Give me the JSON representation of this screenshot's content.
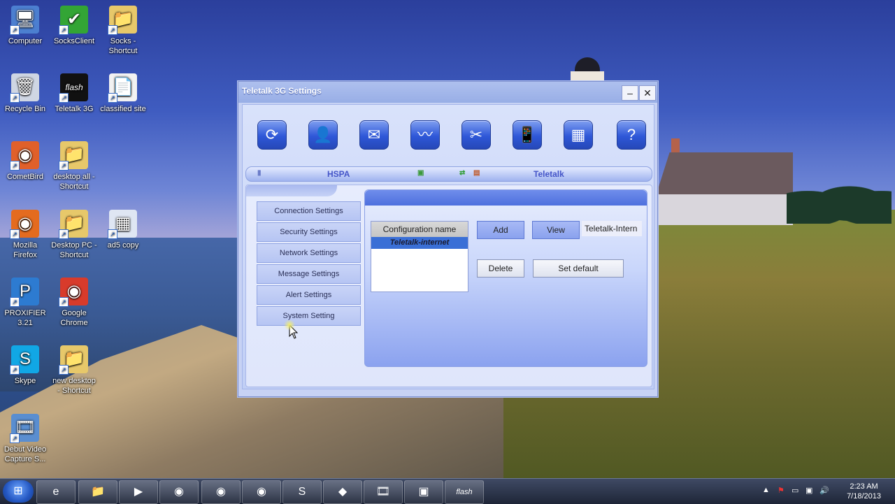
{
  "desktop": {
    "icons": [
      {
        "label": "Computer",
        "glyph": "🖥",
        "color": "#4c7fd0"
      },
      {
        "label": "SocksClient",
        "glyph": "✔",
        "color": "#33a535"
      },
      {
        "label": "Socks -\nShortcut",
        "glyph": "📁",
        "color": "#e7c86a"
      },
      {
        "label": "Recycle Bin",
        "glyph": "🗑",
        "color": "#cfd6e3"
      },
      {
        "label": "Teletalk 3G",
        "glyph": "flash",
        "color": "#111111"
      },
      {
        "label": "classified site",
        "glyph": "📄",
        "color": "#f2f2f2"
      },
      {
        "label": "CometBird",
        "glyph": "◉",
        "color": "#e0602a"
      },
      {
        "label": "desktop all -\nShortcut",
        "glyph": "📁",
        "color": "#e7c86a"
      },
      {
        "label": "Mozilla\nFirefox",
        "glyph": "◉",
        "color": "#e46b1f"
      },
      {
        "label": "Desktop PC -\nShortcut",
        "glyph": "📁",
        "color": "#e7c86a"
      },
      {
        "label": "ad5 copy",
        "glyph": "▦",
        "color": "#dfe6f3"
      },
      {
        "label": "PROXIFIER\n3.21",
        "glyph": "P",
        "color": "#2d7bd1"
      },
      {
        "label": "Google\nChrome",
        "glyph": "◉",
        "color": "#d83b2b"
      },
      {
        "label": "Skype",
        "glyph": "S",
        "color": "#11a7e5"
      },
      {
        "label": "new desktop\n- Shortcut",
        "glyph": "📁",
        "color": "#e7c86a"
      },
      {
        "label": "Debut Video\nCapture S...",
        "glyph": "🎞",
        "color": "#5a8ed0"
      }
    ]
  },
  "window": {
    "title": "Teletalk 3G Settings",
    "minimize": "–",
    "close": "✕",
    "toolbar": [
      {
        "name": "connect-icon",
        "glyph": "⟳"
      },
      {
        "name": "contacts-icon",
        "glyph": "👤"
      },
      {
        "name": "message-icon",
        "glyph": "✉"
      },
      {
        "name": "statistics-icon",
        "glyph": "〰"
      },
      {
        "name": "settings-tools-icon",
        "glyph": "✂"
      },
      {
        "name": "phone-icon",
        "glyph": "📱"
      },
      {
        "name": "sim-card-icon",
        "glyph": "▦"
      },
      {
        "name": "help-icon",
        "glyph": "?"
      }
    ],
    "status": {
      "network_type": "HSPA",
      "operator": "Teletalk"
    },
    "menu": [
      "Connection Settings",
      "Security Settings",
      "Network Settings",
      "Message Settings",
      "Alert Settings",
      "System Setting"
    ],
    "config": {
      "list_header": "Configuration name",
      "selected": "Teletalk-internet",
      "add": "Add",
      "view": "View",
      "value": "Teletalk-Intern",
      "delete": "Delete",
      "set_default": "Set default"
    }
  },
  "taskbar": {
    "start": "⊞",
    "items": [
      "e",
      "📁",
      "▶",
      "◉",
      "◉",
      "◉",
      "S",
      "◆",
      "🎞",
      "▣",
      "flash"
    ],
    "clock_time": "2:23 AM",
    "clock_date": "7/18/2013"
  },
  "colors": {
    "accent": "#2e57d8",
    "selection": "#3a6fd6"
  }
}
